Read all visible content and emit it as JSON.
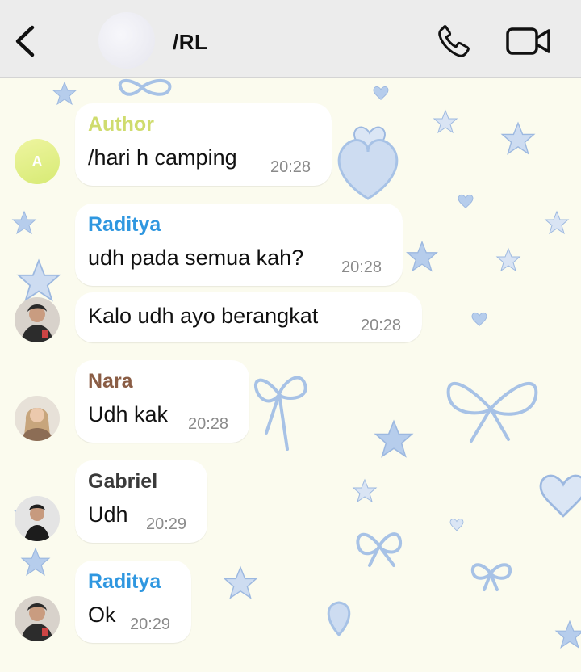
{
  "header": {
    "title": "/RL",
    "back_icon": "chevron-left-icon",
    "call_icon": "phone-icon",
    "video_icon": "video-camera-icon"
  },
  "colors": {
    "author": "#cfdc6e",
    "raditya": "#2f97e0",
    "nara": "#8a5d45",
    "gabriel": "#3a3a3a",
    "wallpaper": "#fbfbee",
    "decor": "#a8c4e8"
  },
  "messages": [
    {
      "sender": "Author",
      "avatar_letter": "A",
      "text": "/hari h camping",
      "time": "20:28"
    },
    {
      "sender": "Raditya",
      "text": "udh pada semua kah?",
      "time": "20:28"
    },
    {
      "text": "Kalo udh ayo berangkat",
      "time": "20:28"
    },
    {
      "sender": "Nara",
      "text": "Udh kak",
      "time": "20:28"
    },
    {
      "sender": "Gabriel",
      "text": "Udh",
      "time": "20:29"
    },
    {
      "sender": "Raditya",
      "text": "Ok",
      "time": "20:29"
    }
  ]
}
